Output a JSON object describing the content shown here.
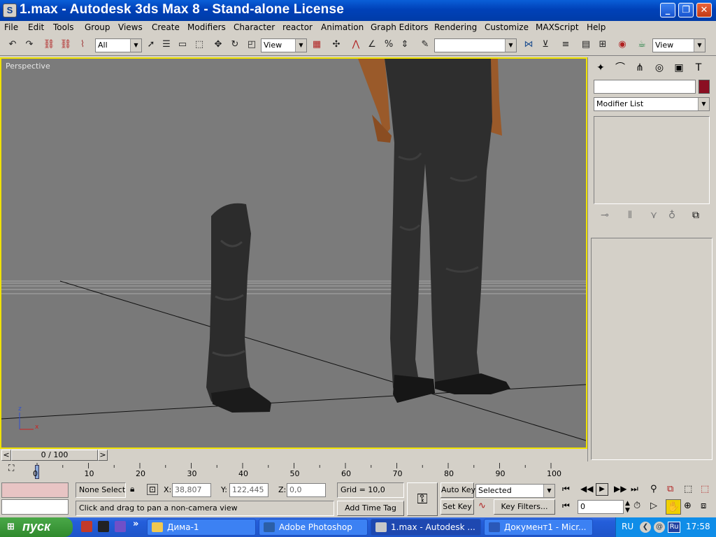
{
  "window": {
    "title": "1.max - Autodesk 3ds Max 8  - Stand-alone License",
    "min": "_",
    "max": "❐",
    "close": "✕"
  },
  "menu": [
    "File",
    "Edit",
    "Tools",
    "Group",
    "Views",
    "Create",
    "Modifiers",
    "Character",
    "reactor",
    "Animation",
    "Graph Editors",
    "Rendering",
    "Customize",
    "MAXScript",
    "Help"
  ],
  "toolbar": {
    "selection_filter": "All",
    "ref_coord": "View",
    "named_sel": "",
    "view2": "View"
  },
  "viewport": {
    "label": "Perspective",
    "axis": {
      "z": "z",
      "x": "x"
    }
  },
  "command_panel": {
    "name_field": "",
    "modifier_list": "Modifier List",
    "color": "#8b0f22"
  },
  "timeline": {
    "frame": "0 / 100",
    "prev": "<",
    "next": ">",
    "ticks": [
      "0",
      "10",
      "20",
      "30",
      "40",
      "50",
      "60",
      "70",
      "80",
      "90",
      "100"
    ]
  },
  "status": {
    "selection": "None Selecte",
    "x_label": "X:",
    "x_value": "38,807",
    "y_label": "Y:",
    "y_value": "122,445",
    "z_label": "Z:",
    "z_value": "0,0",
    "grid": "Grid = 10,0",
    "prompt": "Click and drag to pan a non-camera view",
    "add_time_tag": "Add Time Tag",
    "auto_key": "Auto Key",
    "set_key": "Set Key",
    "key_mode": "Selected",
    "key_filters": "Key Filters...",
    "frame_value": "0"
  },
  "taskbar": {
    "start": "пуск",
    "more": "»",
    "tasks": [
      {
        "label": "Дима-1",
        "icon_color": "#f0c850"
      },
      {
        "label": "Adobe Photoshop",
        "icon_color": "#2b5fa8"
      },
      {
        "label": "1.max - Autodesk ...",
        "icon_color": "#c8c8c8"
      },
      {
        "label": "Документ1 - Micr...",
        "icon_color": "#2a58b8"
      }
    ],
    "lang": "RU",
    "ru_badge": "Ru",
    "clock": "17:58"
  }
}
